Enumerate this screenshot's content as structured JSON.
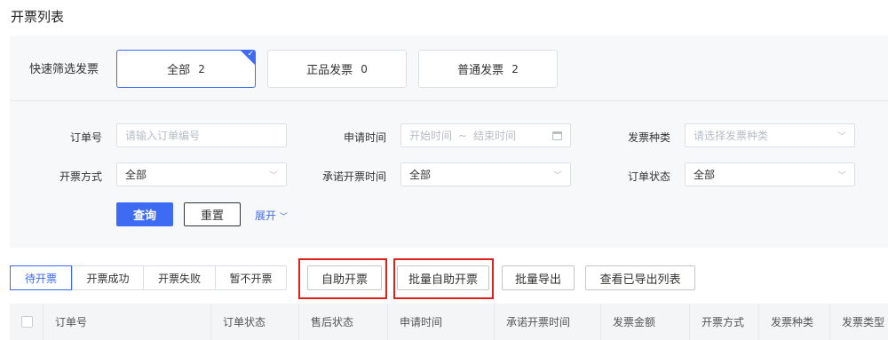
{
  "page": {
    "title": "开票列表"
  },
  "quick_filter": {
    "label": "快速筛选发票",
    "cards": [
      {
        "label": "全部",
        "count": "2",
        "active": true
      },
      {
        "label": "正品发票",
        "count": "0",
        "active": false
      },
      {
        "label": "普通发票",
        "count": "2",
        "active": false
      }
    ]
  },
  "filters": {
    "order_no": {
      "label": "订单号",
      "placeholder": "请输入订单编号"
    },
    "apply_time": {
      "label": "申请时间",
      "start_placeholder": "开始时间",
      "separator": "~",
      "end_placeholder": "结束时间"
    },
    "invoice_type": {
      "label": "发票种类",
      "placeholder": "请选择发票种类"
    },
    "invoice_method": {
      "label": "开票方式",
      "value": "全部"
    },
    "promise_time": {
      "label": "承诺开票时间",
      "value": "全部"
    },
    "order_status": {
      "label": "订单状态",
      "value": "全部"
    }
  },
  "buttons": {
    "query": "查询",
    "reset": "重置",
    "expand": "展开"
  },
  "tabs": [
    "待开票",
    "开票成功",
    "开票失败",
    "暂不开票"
  ],
  "actions": [
    "自助开票",
    "批量自助开票",
    "批量导出",
    "查看已导出列表"
  ],
  "table": {
    "columns": [
      "订单号",
      "订单状态",
      "售后状态",
      "申请时间",
      "承诺开票时间",
      "发票金额",
      "开票方式",
      "发票种类",
      "发票类型"
    ]
  },
  "colors": {
    "accent": "#3d6bf4",
    "highlight": "#e0201b"
  }
}
